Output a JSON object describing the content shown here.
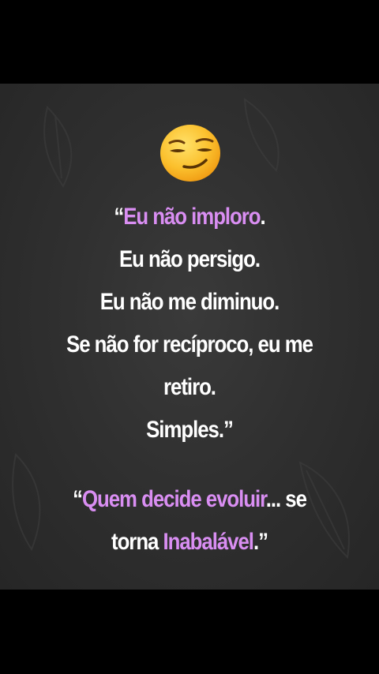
{
  "colors": {
    "background_outer": "#000000",
    "background_panel": "#303030",
    "text": "#ffffff",
    "highlight": "#d98ef2"
  },
  "emoji": {
    "icon": "smirking-face-emoji"
  },
  "quote1": {
    "line1_open": "“",
    "line1_highlight": "Eu não imploro",
    "line1_close": ".",
    "line2": "Eu não persigo.",
    "line3": "Eu não me diminuo.",
    "line4": "Se não for recíproco, eu me",
    "line5": "retiro.",
    "line6": "Simples.”"
  },
  "quote2": {
    "line1_open": "“",
    "line1_highlight": "Quem decide evoluir",
    "line1_rest": "... se",
    "line2_start": "torna ",
    "line2_highlight": "Inabalável",
    "line2_close": ".”"
  }
}
